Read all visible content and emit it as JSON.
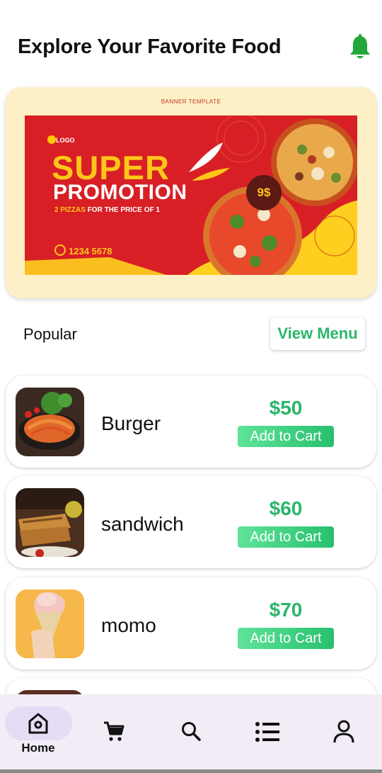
{
  "header": {
    "title": "Explore Your Favorite Food",
    "notification_icon": "bell-icon",
    "accent_color": "#22a83a"
  },
  "banner": {
    "template_label": "BANNER TEMPLATE",
    "logo_text": "LOGO",
    "headline_1": "SUPER",
    "headline_2": "PROMOTION",
    "subline_highlight": "2 PIZZAS",
    "subline_rest": "FOR THE PRICE OF 1",
    "phone": "1234 5678",
    "price_badge": "9$"
  },
  "popular": {
    "label": "Popular",
    "view_menu_label": "View Menu"
  },
  "food_items": [
    {
      "name": "Burger",
      "price": "$50",
      "add_label": "Add to Cart"
    },
    {
      "name": "sandwich",
      "price": "$60",
      "add_label": "Add to Cart"
    },
    {
      "name": "momo",
      "price": "$70",
      "add_label": "Add to Cart"
    }
  ],
  "bottom_nav": {
    "items": [
      {
        "icon": "home-icon",
        "label": "Home",
        "active": true
      },
      {
        "icon": "cart-icon",
        "label": ""
      },
      {
        "icon": "search-icon",
        "label": ""
      },
      {
        "icon": "list-icon",
        "label": ""
      },
      {
        "icon": "profile-icon",
        "label": ""
      }
    ]
  },
  "colors": {
    "price_green": "#2ab66a",
    "button_green": "#27c06e",
    "banner_red": "#d81f26",
    "banner_yellow": "#ffc61a",
    "nav_bg": "#f1ecf6"
  }
}
